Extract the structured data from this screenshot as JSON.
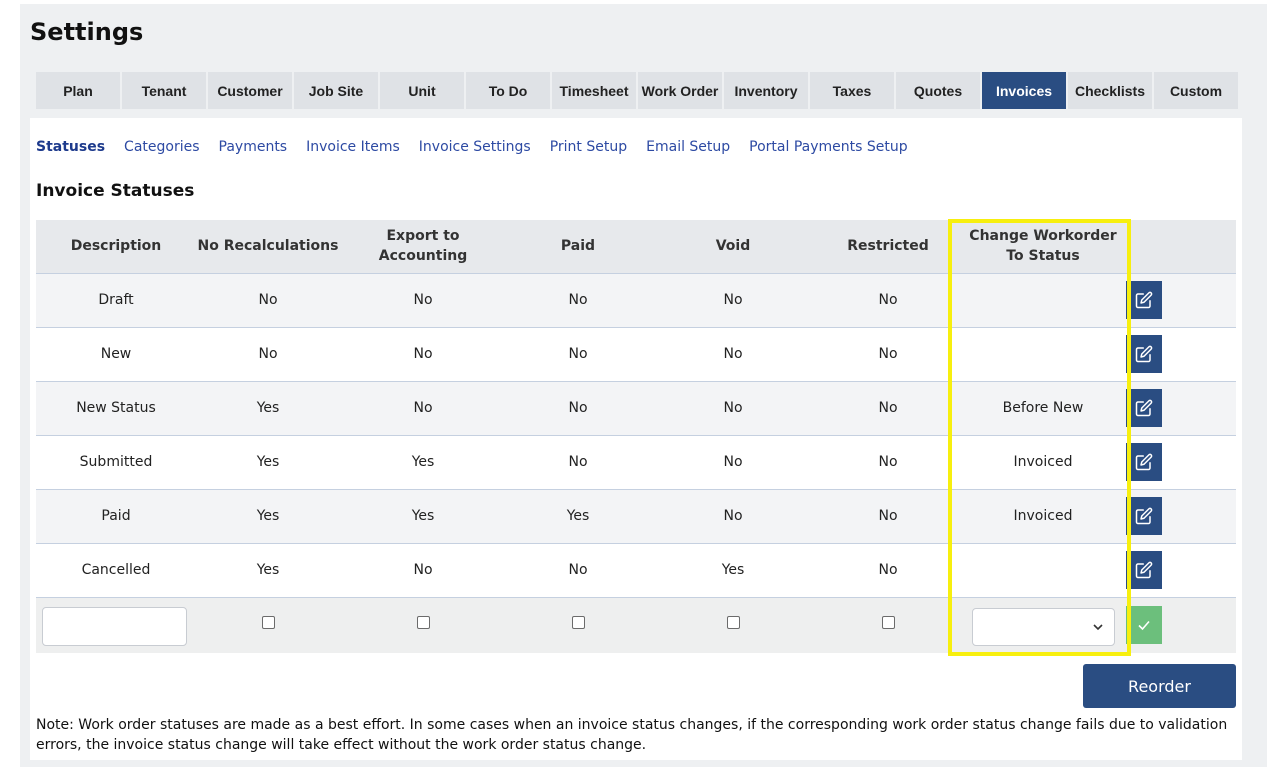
{
  "page": {
    "title": "Settings"
  },
  "tabs": [
    {
      "label": "Plan",
      "active": false
    },
    {
      "label": "Tenant",
      "active": false
    },
    {
      "label": "Customer",
      "active": false
    },
    {
      "label": "Job Site",
      "active": false
    },
    {
      "label": "Unit",
      "active": false
    },
    {
      "label": "To Do",
      "active": false
    },
    {
      "label": "Timesheet",
      "active": false
    },
    {
      "label": "Work Order",
      "active": false
    },
    {
      "label": "Inventory",
      "active": false
    },
    {
      "label": "Taxes",
      "active": false
    },
    {
      "label": "Quotes",
      "active": false
    },
    {
      "label": "Invoices",
      "active": true
    },
    {
      "label": "Checklists",
      "active": false
    },
    {
      "label": "Custom",
      "active": false
    }
  ],
  "subnav": [
    {
      "label": "Statuses",
      "active": true
    },
    {
      "label": "Categories",
      "active": false
    },
    {
      "label": "Payments",
      "active": false
    },
    {
      "label": "Invoice Items",
      "active": false
    },
    {
      "label": "Invoice Settings",
      "active": false
    },
    {
      "label": "Print Setup",
      "active": false
    },
    {
      "label": "Email Setup",
      "active": false
    },
    {
      "label": "Portal Payments Setup",
      "active": false
    }
  ],
  "section_title": "Invoice Statuses",
  "table": {
    "headers": {
      "description": "Description",
      "no_recalc": "No Recalculations",
      "export_line1": "Export to",
      "export_line2": "Accounting",
      "paid": "Paid",
      "void": "Void",
      "restricted": "Restricted",
      "change_line1": "Change Workorder",
      "change_line2": "To Status"
    },
    "rows": [
      {
        "description": "Draft",
        "no_recalc": "No",
        "export": "No",
        "paid": "No",
        "void": "No",
        "restricted": "No",
        "change_to": ""
      },
      {
        "description": "New",
        "no_recalc": "No",
        "export": "No",
        "paid": "No",
        "void": "No",
        "restricted": "No",
        "change_to": ""
      },
      {
        "description": "New Status",
        "no_recalc": "Yes",
        "export": "No",
        "paid": "No",
        "void": "No",
        "restricted": "No",
        "change_to": "Before New"
      },
      {
        "description": "Submitted",
        "no_recalc": "Yes",
        "export": "Yes",
        "paid": "No",
        "void": "No",
        "restricted": "No",
        "change_to": "Invoiced"
      },
      {
        "description": "Paid",
        "no_recalc": "Yes",
        "export": "Yes",
        "paid": "Yes",
        "void": "No",
        "restricted": "No",
        "change_to": "Invoiced"
      },
      {
        "description": "Cancelled",
        "no_recalc": "Yes",
        "export": "No",
        "paid": "No",
        "void": "Yes",
        "restricted": "No",
        "change_to": ""
      }
    ],
    "new_row": {
      "description_value": "",
      "change_to_selected": ""
    }
  },
  "icons": {
    "edit": "edit-icon",
    "save": "check-icon",
    "dropdown": "chevron-down-icon"
  },
  "colors": {
    "accent": "#2a4d82",
    "save": "#6cbf7c",
    "highlight": "#f7ef0e"
  },
  "reorder_label": "Reorder",
  "note": "Note: Work order statuses are made as a best effort. In some cases when an invoice status changes, if the corresponding work order status change fails due to validation errors, the invoice status change will take effect without the work order status change."
}
